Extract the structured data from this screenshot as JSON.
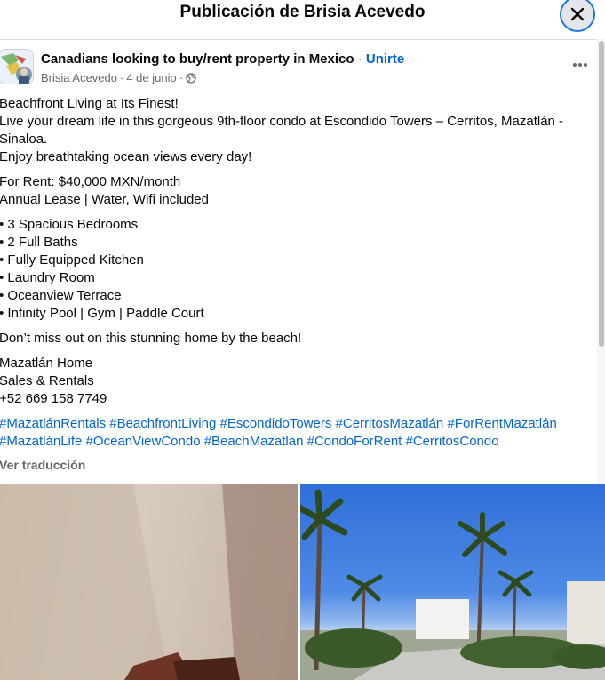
{
  "header": {
    "title": "Publicación de Brisia Acevedo",
    "close_icon": "close-icon"
  },
  "post": {
    "group_name": "Canadians looking to buy/rent property in Mexico",
    "separator": "·",
    "join_label": "Unirte",
    "author": "Brisia Acevedo",
    "date": "4 de junio",
    "audience_icon": "globe-icon",
    "more_icon": "more-options-icon",
    "text": {
      "l1": "Beachfront Living at Its Finest!",
      "l2": "Live your dream life in this gorgeous 9th-floor condo at Escondido Towers – Cerritos, Mazatlán -",
      "l3": "Sinaloa.",
      "l4": "Enjoy breathtaking ocean views every day!",
      "l5": "For Rent: $40,000 MXN/month",
      "l6": "Annual Lease | Water, Wifi included",
      "b1": "• 3 Spacious Bedrooms",
      "b2": "• 2 Full Baths",
      "b3": "• Fully Equipped Kitchen",
      "b4": "• Laundry Room",
      "b5": "• Oceanview Terrace",
      "b6": "• Infinity Pool | Gym | Paddle Court",
      "l7": "Don’t miss out on this stunning home by the beach!",
      "c1": "Mazatlán Home",
      "c2": "Sales & Rentals",
      "c3": "+52 669 158 7749"
    },
    "hashtags": {
      "h1": "#MazatlánRentals #BeachfrontLiving #EscondidoTowers #CerritosMazatlán #ForRentMazatlán",
      "h2": "#MazatlánLife #OceanViewCondo #BeachMazatlan #CondoForRent #CerritosCondo"
    },
    "translate_label": "Ver traducción"
  },
  "colors": {
    "link": "#0064d1",
    "muted": "#65676b",
    "text": "#050505"
  }
}
